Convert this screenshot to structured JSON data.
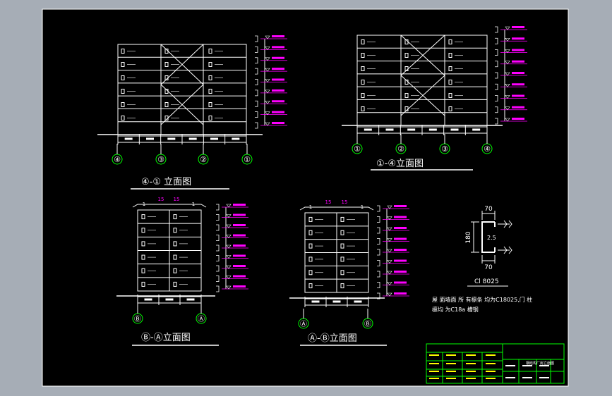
{
  "colors": {
    "background": "#a6adb6",
    "sheet": "#000000",
    "line": "#ffffff",
    "level": "#ff00ff",
    "axis": "#00ff00",
    "tag": "#ffff00"
  },
  "elevations": {
    "e41": {
      "title": "④-① 立面图",
      "axes": [
        "④",
        "③",
        "②",
        "①"
      ]
    },
    "e14": {
      "title": "①-④立面图",
      "axes": [
        "①",
        "②",
        "③",
        "④"
      ]
    },
    "eba": {
      "title": "Ⓑ-Ⓐ立面图",
      "axes": [
        "Ⓑ",
        "Ⓐ"
      ],
      "dims_top": [
        "1",
        "15",
        "15",
        "1"
      ]
    },
    "eab": {
      "title": "Ⓐ-Ⓑ立面图",
      "axes": [
        "Ⓐ",
        "Ⓑ"
      ],
      "dims_top": [
        "1",
        "15",
        "15",
        "1"
      ]
    }
  },
  "section": {
    "dims": {
      "top": "70",
      "height": "180",
      "thickness": "2.5",
      "bottom": "70"
    },
    "label": "Cl 8025"
  },
  "note": {
    "line1": "屋 面墙面 所 有檩条 均为C18025,门 柱",
    "line2": "檩均 为C18a 槽钢"
  },
  "title_block": {
    "name": "钢结构厂房立面图"
  }
}
